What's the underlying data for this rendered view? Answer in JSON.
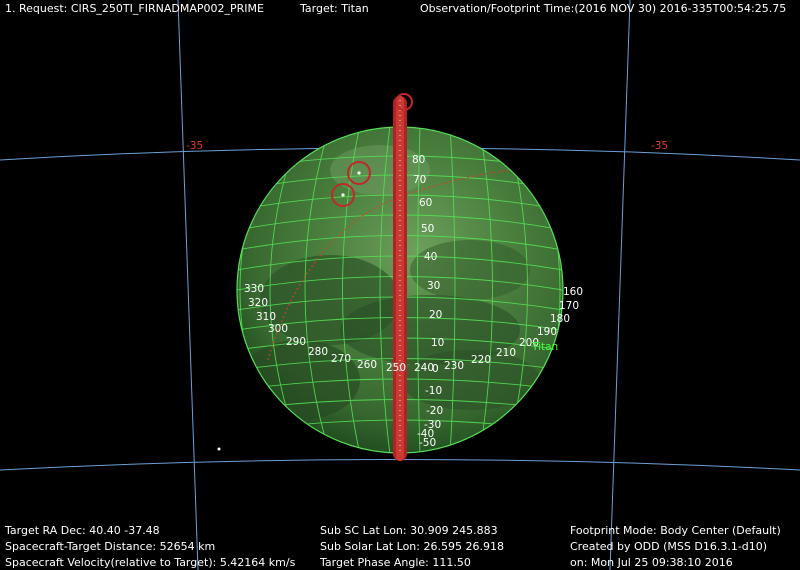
{
  "header": {
    "request": "1. Request: CIRS_250TI_FIRNADMAP002_PRIME",
    "target": "Target: Titan",
    "observation_time": "Observation/Footprint Time:(2016 NOV 30) 2016-335T00:54:25.75"
  },
  "sky_grid": {
    "dec_label_left": "-35",
    "dec_label_right": "-35"
  },
  "body": {
    "name_label": "Titan",
    "latitude_labels": [
      "80",
      "70",
      "60",
      "50",
      "40",
      "30",
      "20",
      "10",
      "0",
      "-10",
      "-20",
      "-30",
      "-40",
      "-50"
    ],
    "longitude_labels": [
      "330",
      "320",
      "310",
      "300",
      "290",
      "280",
      "270",
      "260",
      "250",
      "240",
      "230",
      "220",
      "210",
      "200",
      "190",
      "180",
      "170",
      "160"
    ]
  },
  "footer": {
    "ra_dec": "Target RA Dec: 40.40   -37.48",
    "distance": "Spacecraft-Target Distance:    52654 km",
    "velocity": "Spacecraft Velocity(relative to Target): 5.42164 km/s",
    "sub_sc": "Sub SC Lat Lon: 30.909  245.883",
    "sub_solar": "Sub Solar Lat Lon: 26.595   26.918",
    "phase": "Target Phase Angle: 111.50",
    "footprint_mode": "Footprint Mode: Body Center (Default)",
    "created_by": "Created by ODD (MSS D16.3.1-d10)",
    "created_on": "on: Mon Jul 25 09:38:10 2016"
  },
  "colors": {
    "background": "#000000",
    "sky_grid": "#6a9fd6",
    "body_fill": "#3f8a3c",
    "body_grid": "#55e055",
    "footprint": "#c0282a",
    "label_red": "#e03a2c",
    "label_green": "#3cff3c",
    "text": "#ffffff"
  }
}
